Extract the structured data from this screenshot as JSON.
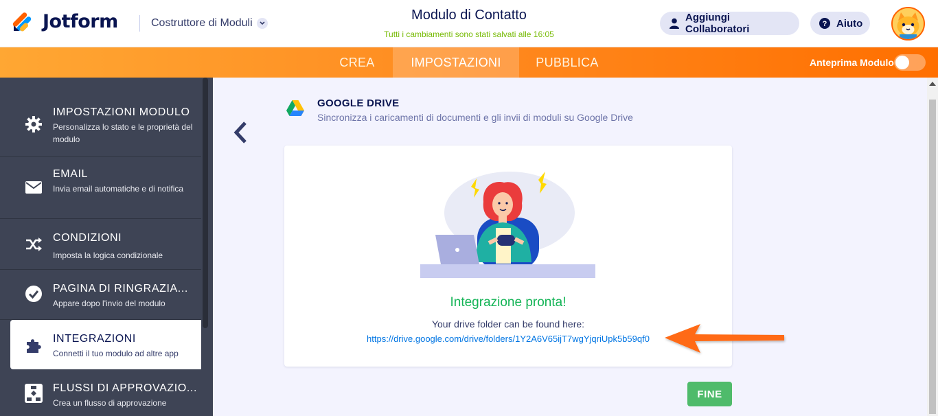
{
  "header": {
    "logo_text": "Jotform",
    "builder_label": "Costruttore di Moduli",
    "form_title": "Modulo di Contatto",
    "save_status": "Tutti i cambiamenti sono stati salvati alle 16:05",
    "collab_label": "Aggiungi Collaboratori",
    "help_label": "Aiuto"
  },
  "nav": {
    "tabs": [
      {
        "label": "CREA"
      },
      {
        "label": "IMPOSTAZIONI"
      },
      {
        "label": "PUBBLICA"
      }
    ],
    "active_tab": "IMPOSTAZIONI",
    "preview_label": "Anteprima Modulo",
    "preview_enabled": false
  },
  "sidebar": {
    "items": [
      {
        "title": "IMPOSTAZIONI MODULO",
        "desc": "Personalizza lo stato e le proprietà del modulo",
        "icon": "gear-icon"
      },
      {
        "title": "EMAIL",
        "desc": "Invia email automatiche e di notifica",
        "icon": "envelope-icon"
      },
      {
        "title": "CONDIZIONI",
        "desc": "Imposta la logica condizionale",
        "icon": "shuffle-icon"
      },
      {
        "title": "PAGINA DI RINGRAZIA...",
        "desc": "Appare dopo l'invio del modulo",
        "icon": "check-circle-icon"
      },
      {
        "title": "INTEGRAZIONI",
        "desc": "Connetti il tuo modulo ad altre app",
        "icon": "puzzle-icon"
      },
      {
        "title": "FLUSSI DI APPROVAZIO...",
        "desc": "Crea un flusso di approvazione",
        "icon": "flowchart-icon"
      }
    ],
    "active_item": "INTEGRAZIONI"
  },
  "integration": {
    "title": "GOOGLE DRIVE",
    "subtitle": "Sincronizza i caricamenti di documenti e gli invii di moduli su Google Drive",
    "ready_title": "Integrazione pronta!",
    "found_text": "Your drive folder can be found here:",
    "folder_link": "https://drive.google.com/drive/folders/1Y2A6V65ijT7wgYjqriUpk5b59qf0",
    "done_label": "FINE"
  },
  "colors": {
    "brand_orange": "#ff6100",
    "sidebar_bg": "#3e4455",
    "success_green": "#14b456",
    "done_button": "#4fbb6b",
    "link_blue": "#0075e3",
    "navy": "#0a1551"
  }
}
